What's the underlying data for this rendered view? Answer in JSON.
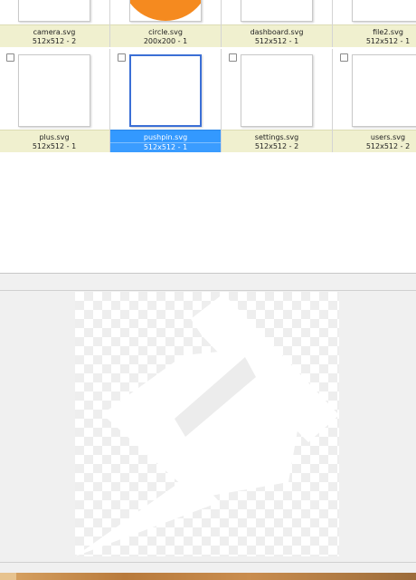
{
  "files": [
    {
      "name": "camera.svg",
      "dims": "512x512 - 2",
      "selected": false,
      "row": 0,
      "col": 0
    },
    {
      "name": "circle.svg",
      "dims": "200x200 - 1",
      "selected": false,
      "row": 0,
      "col": 1
    },
    {
      "name": "dashboard.svg",
      "dims": "512x512 - 1",
      "selected": false,
      "row": 0,
      "col": 2
    },
    {
      "name": "file2.svg",
      "dims": "512x512 - 1",
      "selected": false,
      "row": 0,
      "col": 3
    },
    {
      "name": "plus.svg",
      "dims": "512x512 - 1",
      "selected": false,
      "row": 1,
      "col": 0
    },
    {
      "name": "pushpin.svg",
      "dims": "512x512 - 1",
      "selected": true,
      "row": 1,
      "col": 1
    },
    {
      "name": "settings.svg",
      "dims": "512x512 - 2",
      "selected": false,
      "row": 1,
      "col": 2
    },
    {
      "name": "users.svg",
      "dims": "512x512 - 2",
      "selected": false,
      "row": 1,
      "col": 3
    }
  ],
  "preview": {
    "icon": "pushpin-icon",
    "checkerboard": true
  },
  "colors": {
    "selection": "#3399ff",
    "caption_bg": "#f0f0cf",
    "circle_fill": "#f58a1f"
  }
}
